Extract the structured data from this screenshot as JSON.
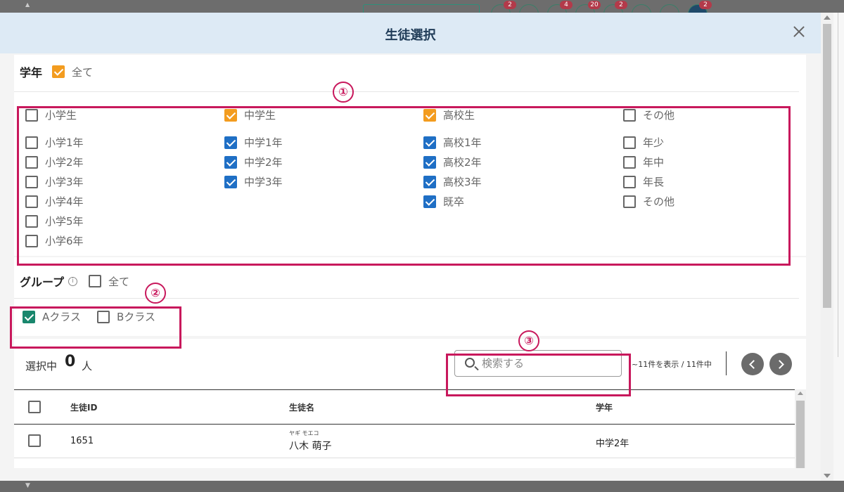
{
  "background": {
    "badges": [
      "2",
      "4",
      "20",
      "2",
      "2"
    ]
  },
  "dialog": {
    "title": "生徒選択"
  },
  "grade": {
    "title": "学年",
    "all_label": "全て",
    "all_checked": true,
    "columns": [
      {
        "header": {
          "label": "小学生",
          "checked": false
        },
        "items": [
          {
            "label": "小学1年",
            "checked": false
          },
          {
            "label": "小学2年",
            "checked": false
          },
          {
            "label": "小学3年",
            "checked": false
          },
          {
            "label": "小学4年",
            "checked": false
          },
          {
            "label": "小学5年",
            "checked": false
          },
          {
            "label": "小学6年",
            "checked": false
          }
        ]
      },
      {
        "header": {
          "label": "中学生",
          "checked": true
        },
        "items": [
          {
            "label": "中学1年",
            "checked": true
          },
          {
            "label": "中学2年",
            "checked": true
          },
          {
            "label": "中学3年",
            "checked": true
          }
        ]
      },
      {
        "header": {
          "label": "高校生",
          "checked": true
        },
        "items": [
          {
            "label": "高校1年",
            "checked": true
          },
          {
            "label": "高校2年",
            "checked": true
          },
          {
            "label": "高校3年",
            "checked": true
          },
          {
            "label": "既卒",
            "checked": true
          }
        ]
      },
      {
        "header": {
          "label": "その他",
          "checked": false
        },
        "items": [
          {
            "label": "年少",
            "checked": false
          },
          {
            "label": "年中",
            "checked": false
          },
          {
            "label": "年長",
            "checked": false
          },
          {
            "label": "その他",
            "checked": false
          }
        ]
      }
    ]
  },
  "group": {
    "title": "グループ",
    "info_icon": "i",
    "all_label": "全て",
    "all_checked": false,
    "items": [
      {
        "label": "Aクラス",
        "checked": true
      },
      {
        "label": "Bクラス",
        "checked": false
      }
    ]
  },
  "annotations": [
    "①",
    "②",
    "③"
  ],
  "list": {
    "selected_label": "選択中",
    "selected_count": "0",
    "selected_unit": "人",
    "search_placeholder": "検索する",
    "paging_info": "~11件を表示 / 11件中",
    "columns": [
      "生徒ID",
      "生徒名",
      "学年"
    ],
    "rows": [
      {
        "id": "1651",
        "kana": "ヤギ モエコ",
        "name": "八木 萌子",
        "grade": "中学2年"
      }
    ]
  },
  "colors": {
    "accent_orange": "#f39c1f",
    "accent_blue": "#1f6fc5",
    "accent_green": "#19876d",
    "annotation": "#c8185c"
  }
}
